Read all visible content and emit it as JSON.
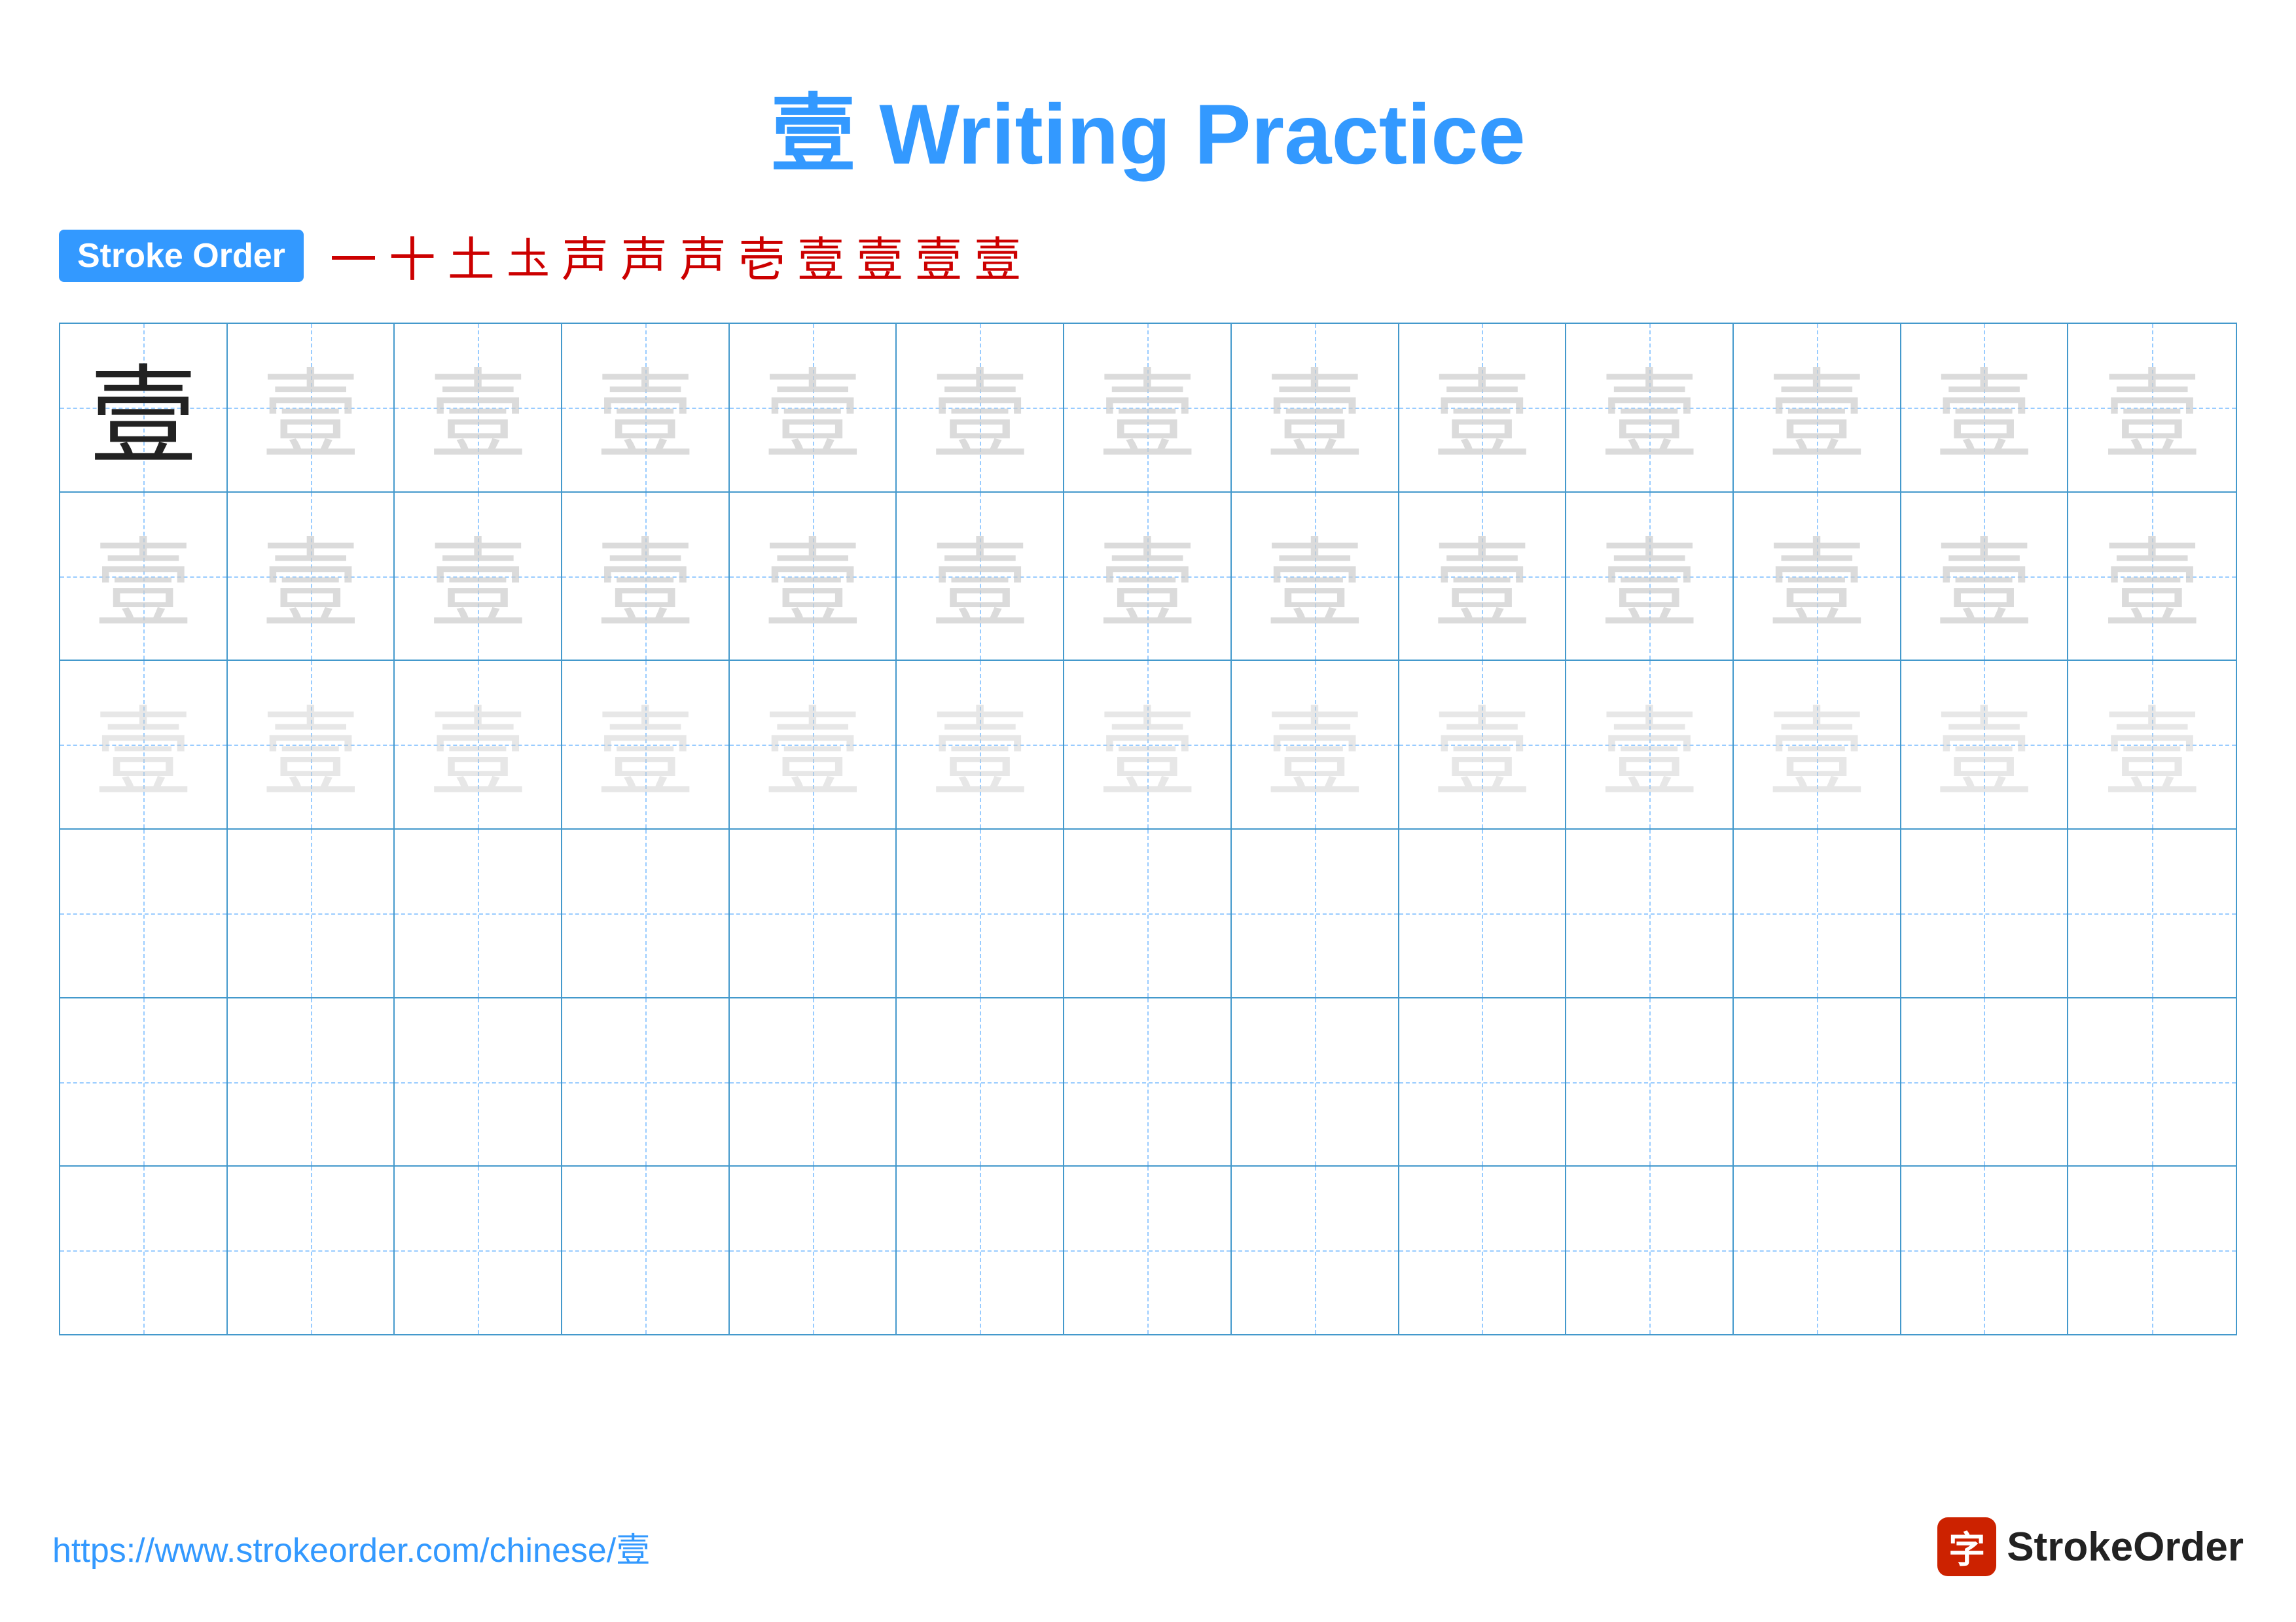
{
  "title": {
    "char": "壹",
    "text": " Writing Practice"
  },
  "stroke_order": {
    "badge_label": "Stroke Order",
    "steps": [
      "一",
      "十",
      "土",
      "圡",
      "声",
      "声",
      "声",
      "壱",
      "壹",
      "壹",
      "壹",
      "壹"
    ]
  },
  "grid": {
    "rows": 6,
    "cols": 13,
    "char": "壹",
    "row_types": [
      "dark_then_light",
      "light",
      "lighter",
      "empty",
      "empty",
      "empty"
    ]
  },
  "footer": {
    "url": "https://www.strokeorder.com/chinese/壹",
    "logo_char": "字",
    "logo_text": "StrokeOrder"
  }
}
